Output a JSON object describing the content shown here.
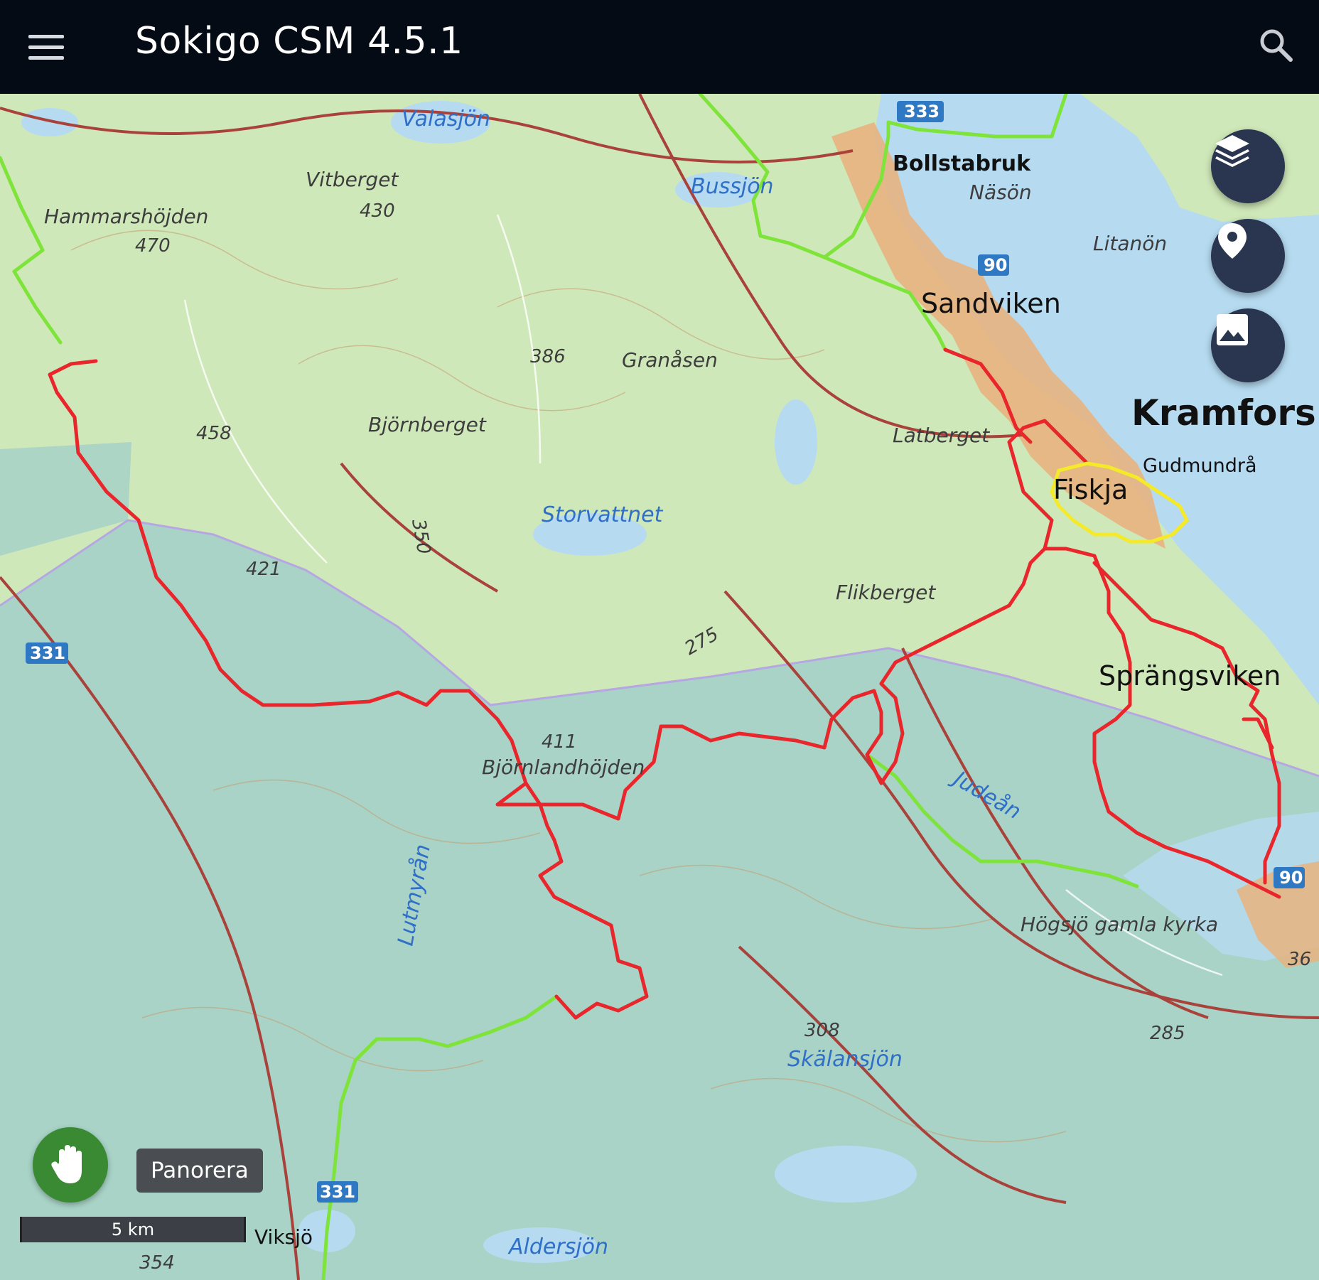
{
  "app": {
    "title": "Sokigo CSM 4.5.1"
  },
  "icons": {
    "menu": "hamburger-menu-icon",
    "search": "search-icon",
    "layers": "layers-icon",
    "location": "location-pin-icon",
    "image": "image-icon",
    "pan": "hand-icon"
  },
  "colors": {
    "appbar": "#050b14",
    "fab": "#2a3650",
    "pan_button": "#3a8a34",
    "route_red": "#e8262b",
    "route_green": "#7ee43a",
    "route_yellow": "#f4ea2a",
    "land": "#cde7b7",
    "water": "#b7dcf2",
    "protected_area": "#a6d2c7"
  },
  "map": {
    "place_names": {
      "valasjon": "Valasjön",
      "vitberget": "Vitberget",
      "hammarshojden": "Hammarshöjden",
      "bussjon": "Bussjön",
      "bollstabruk": "Bollstabruk",
      "nason": "Näsön",
      "litanon": "Litanön",
      "sandviken": "Sandviken",
      "granasen": "Granåsen",
      "bjornberget": "Björnberget",
      "kramfors": "Kramfors",
      "latberget": "Latberget",
      "gudmundra": "Gudmundrå",
      "fiskja": "Fiskja",
      "storvattnet": "Storvattnet",
      "flikberget": "Flikberget",
      "sprangsviken": "Sprängsviken",
      "lutmyran": "Lutmyrån",
      "bjornlandhojden": "Björnlandhöjden",
      "judean": "Judeån",
      "hogsjo": "Högsjö gamla kyrka",
      "skalansjon": "Skälansjön",
      "aldersjon": "Aldersjön",
      "viksjo": "Viksjö"
    },
    "elevations": {
      "e430": "430",
      "e470": "470",
      "e386": "386",
      "e458": "458",
      "e421": "421",
      "e411": "411",
      "e350": "350",
      "e275": "275",
      "e308": "308",
      "e285": "285",
      "e354": "354",
      "e36": "36"
    },
    "road_numbers": {
      "r333": "333",
      "r90a": "90",
      "r331a": "331",
      "r90b": "90",
      "r331b": "331"
    }
  },
  "controls": {
    "pan_label": "Panorera",
    "scale_label": "5 km"
  }
}
